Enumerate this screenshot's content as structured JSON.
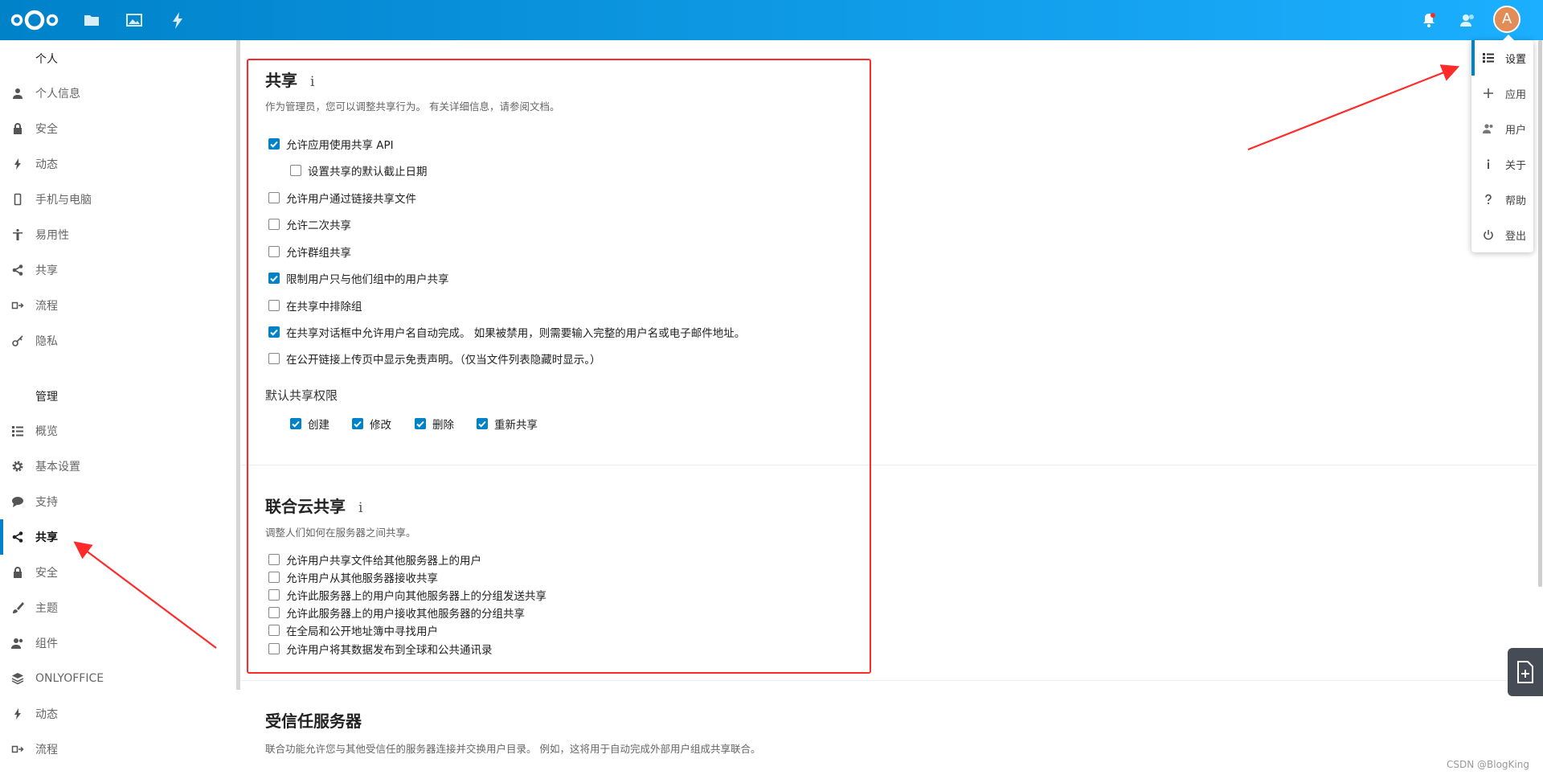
{
  "header": {
    "icons": [
      "nextcloud-logo",
      "files-icon",
      "photos-icon",
      "activity-icon",
      "notifications-icon",
      "contacts-icon"
    ],
    "avatar_letter": "A",
    "brand_color": "#0082c9",
    "notification_dot_color": "#e9322d"
  },
  "sidebar": {
    "personal_caption": "个人",
    "personal_items": [
      {
        "label": "个人信息",
        "icon": "person-icon"
      },
      {
        "label": "安全",
        "icon": "lock-icon"
      },
      {
        "label": "动态",
        "icon": "activity-icon"
      },
      {
        "label": "手机与电脑",
        "icon": "phone-icon"
      },
      {
        "label": "易用性",
        "icon": "accessibility-icon"
      },
      {
        "label": "共享",
        "icon": "share-icon"
      },
      {
        "label": "流程",
        "icon": "flow-icon"
      },
      {
        "label": "隐私",
        "icon": "key-icon"
      }
    ],
    "admin_caption": "管理",
    "admin_items": [
      {
        "label": "概览",
        "icon": "list-icon"
      },
      {
        "label": "基本设置",
        "icon": "gear-icon"
      },
      {
        "label": "支持",
        "icon": "speech-bubble-icon"
      },
      {
        "label": "共享",
        "icon": "share-icon",
        "active": true
      },
      {
        "label": "安全",
        "icon": "lock-icon"
      },
      {
        "label": "主题",
        "icon": "paintbrush-icon"
      },
      {
        "label": "组件",
        "icon": "group-icon"
      },
      {
        "label": "ONLYOFFICE",
        "icon": "layers-icon"
      },
      {
        "label": "动态",
        "icon": "activity-icon"
      },
      {
        "label": "流程",
        "icon": "flow-icon"
      }
    ]
  },
  "sharing": {
    "title": "共享",
    "info": "i",
    "description": "作为管理员，您可以调整共享行为。 有关详细信息，请参阅文档。",
    "options": [
      {
        "label": "允许应用使用共享 API",
        "checked": true
      },
      {
        "label": "设置共享的默认截止日期",
        "checked": false
      },
      {
        "label": "允许用户通过链接共享文件",
        "checked": false
      },
      {
        "label": "允许二次共享",
        "checked": false
      },
      {
        "label": "允许群组共享",
        "checked": false
      },
      {
        "label": "限制用户只与他们组中的用户共享",
        "checked": true
      },
      {
        "label": "在共享中排除组",
        "checked": false
      },
      {
        "label": "在共享对话框中允许用户名自动完成。 如果被禁用，则需要输入完整的用户名或电子邮件地址。",
        "checked": true
      },
      {
        "label": "在公开链接上传页中显示免责声明。（仅当文件列表隐藏时显示。）",
        "checked": false
      }
    ],
    "permissions_heading": "默认共享权限",
    "permissions": [
      {
        "label": "创建",
        "checked": true
      },
      {
        "label": "修改",
        "checked": true
      },
      {
        "label": "删除",
        "checked": true
      },
      {
        "label": "重新共享",
        "checked": true
      }
    ]
  },
  "federated": {
    "title": "联合云共享",
    "info": "i",
    "description": "调整人们如何在服务器之间共享。",
    "options": [
      {
        "label": "允许用户共享文件给其他服务器上的用户",
        "checked": false
      },
      {
        "label": "允许用户从其他服务器接收共享",
        "checked": false
      },
      {
        "label": "允许此服务器上的用户向其他服务器上的分组发送共享",
        "checked": false
      },
      {
        "label": "允许此服务器上的用户接收其他服务器的分组共享",
        "checked": false
      },
      {
        "label": "在全局和公开地址簿中寻找用户",
        "checked": false
      },
      {
        "label": "允许用户将其数据发布到全球和公共通讯录",
        "checked": false
      }
    ]
  },
  "trusted": {
    "title": "受信任服务器",
    "description": "联合功能允许您与其他受信任的服务器连接并交换用户目录。 例如，这将用于自动完成外部用户组成共享联合。"
  },
  "user_menu": {
    "items": [
      {
        "label": "设置",
        "icon": "settings-list-icon",
        "active": true
      },
      {
        "label": "应用",
        "icon": "plus-icon"
      },
      {
        "label": "用户",
        "icon": "users-icon"
      },
      {
        "label": "关于",
        "icon": "info-icon"
      },
      {
        "label": "帮助",
        "icon": "help-icon"
      },
      {
        "label": "登出",
        "icon": "power-icon"
      }
    ]
  },
  "watermark": "CSDN @BlogKing",
  "annotation_color": "#ff2a2a"
}
